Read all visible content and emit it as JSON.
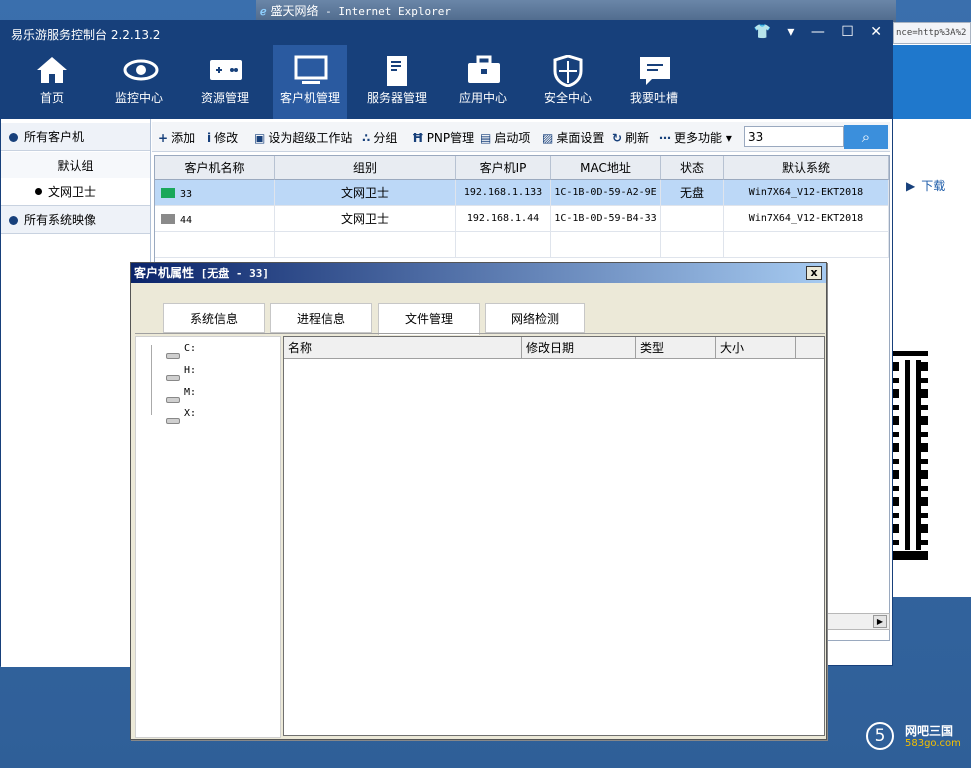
{
  "ie": {
    "title": "盛天网络",
    "title_suffix": " - Internet Explorer",
    "url_fragment": "nce=http%3A%2",
    "download_label": "下载"
  },
  "app": {
    "title": "易乐游服务控制台 2.2.13.2",
    "window_controls": "👕 ▾ — ☐ ✕"
  },
  "nav": {
    "items": [
      {
        "label": "首页",
        "icon": "home-icon"
      },
      {
        "label": "监控中心",
        "icon": "eye-icon"
      },
      {
        "label": "资源管理",
        "icon": "gamepad-icon"
      },
      {
        "label": "客户机管理",
        "icon": "monitor-icon"
      },
      {
        "label": "服务器管理",
        "icon": "server-icon"
      },
      {
        "label": "应用中心",
        "icon": "toolbox-icon"
      },
      {
        "label": "安全中心",
        "icon": "shield-icon"
      },
      {
        "label": "我要吐槽",
        "icon": "chat-icon"
      }
    ],
    "active_index": 3
  },
  "sidebar": {
    "all_clients": "所有客户机",
    "default_group": "默认组",
    "group_leaf": "文网卫士",
    "all_images": "所有系统映像"
  },
  "toolbar": {
    "add": "添加",
    "edit": "修改",
    "super_ws": "设为超级工作站",
    "group": "分组",
    "pnp": "PNP管理",
    "startup": "启动项",
    "desktop": "桌面设置",
    "refresh": "刷新",
    "more": "更多功能",
    "search_value": "33"
  },
  "grid": {
    "columns": [
      "客户机名称",
      "组别",
      "客户机IP",
      "MAC地址",
      "状态",
      "默认系统"
    ],
    "rows": [
      {
        "name": "33",
        "group": "文网卫士",
        "ip": "192.168.1.133",
        "mac": "1C-1B-0D-59-A2-9E",
        "status": "无盘",
        "os": "Win7X64_V12-EKT2018",
        "online": true
      },
      {
        "name": "44",
        "group": "文网卫士",
        "ip": "192.168.1.44",
        "mac": "1C-1B-0D-59-B4-33",
        "status": "",
        "os": "Win7X64_V12-EKT2018",
        "online": false
      }
    ]
  },
  "dialog": {
    "title_prefix": "客户机属性",
    "title_detail": " [无盘 - 33]",
    "close": "x",
    "tabs": [
      "系统信息",
      "进程信息",
      "文件管理",
      "网络检测"
    ],
    "active_tab": 2,
    "drives": [
      "C:",
      "H:",
      "M:",
      "X:"
    ],
    "file_columns": [
      "名称",
      "修改日期",
      "类型",
      "大小"
    ]
  },
  "watermark": {
    "digit": "5",
    "name": "网吧三国",
    "site": "583go.com"
  },
  "colors": {
    "nav_bg": "#17407b",
    "accent": "#3b8fdc",
    "online_pc": "#1aa85a",
    "offline_pc": "#8a8a8a"
  }
}
